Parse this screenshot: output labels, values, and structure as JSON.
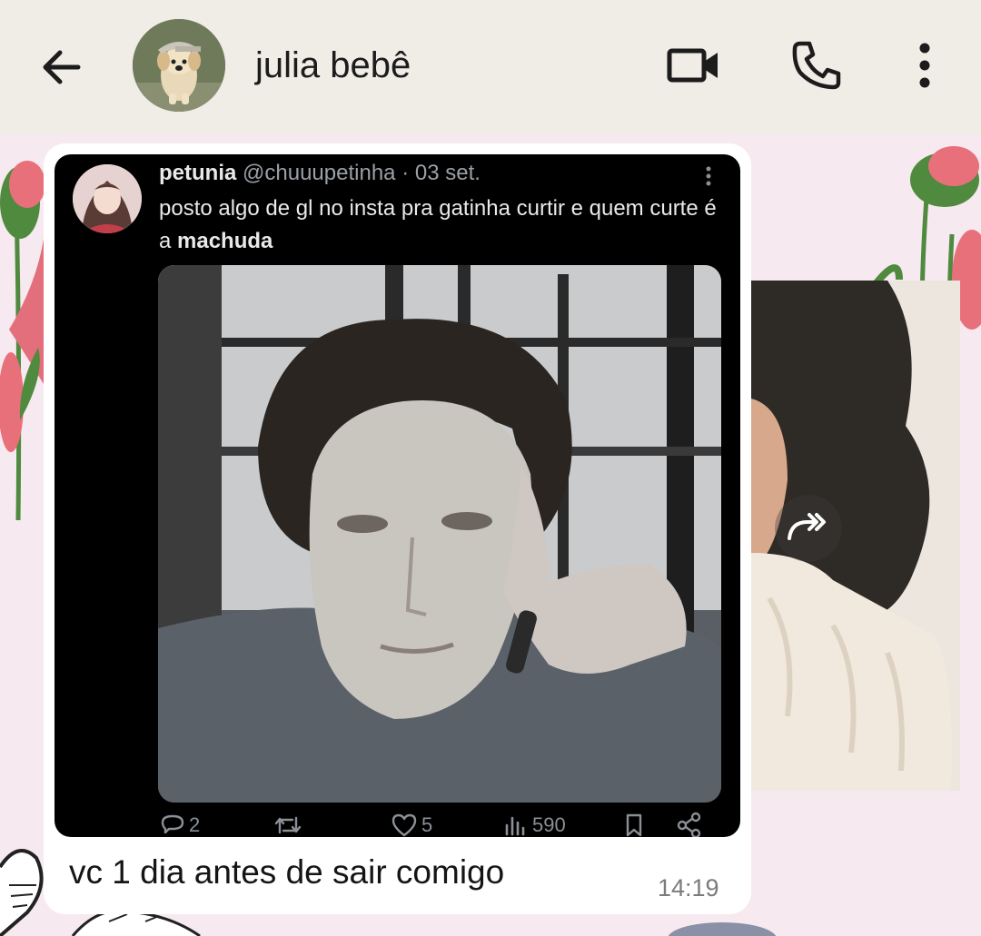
{
  "header": {
    "contact_name": "julia bebê",
    "back_icon": "arrow-left-icon",
    "avatar_icon": "dog-avatar",
    "video_call_icon": "video-camera-icon",
    "voice_call_icon": "phone-icon",
    "menu_icon": "more-vertical-icon"
  },
  "message": {
    "tweet": {
      "display_name": "petunia",
      "handle": "@chuuupetinha",
      "separator": "·",
      "date": "03 set.",
      "text_part1": "posto algo de gl no insta pra gatinha curtir e quem curte é a ",
      "text_bold": "machuda",
      "replies": "2",
      "retweets": "",
      "likes": "5",
      "views": "590"
    },
    "caption": "vc 1 dia antes de sair comigo",
    "time": "14:19"
  },
  "colors": {
    "header_bg": "#f0ece6",
    "wallpaper_bg": "#f6e9ef",
    "bubble_bg": "#ffffff",
    "tweet_bg": "#000000",
    "flower_pink": "#e8707a",
    "stem_green": "#4f8a3e"
  }
}
